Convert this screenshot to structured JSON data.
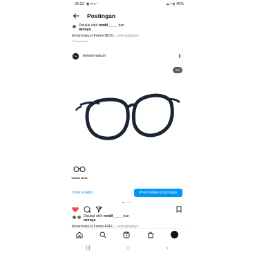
{
  "status_bar": {
    "time": "09.22",
    "battery": "45%",
    "left_glyphs": "▣ ✉ ▸ •",
    "right_glyphs": "☁ ▾ ▮"
  },
  "header": {
    "title": "Postingan"
  },
  "previous_post": {
    "liked_prefix": "Disukai oleh ",
    "liked_user": "rendil_____",
    "liked_mid": " dan ",
    "liked_suffix": "lainnya",
    "caption_user": "temanmata.in",
    "caption_text": " Frame NIOO...",
    "caption_more": " selengkapnya",
    "date": "5 September"
  },
  "post": {
    "username": "temanmata.in",
    "avatar_label": "TM",
    "counter": "1/4",
    "brand_label": "TEMAN MATA"
  },
  "actions": {
    "insight": "Lihat Insight",
    "promote": "Promosikan postingan"
  },
  "next_post": {
    "liked_prefix": "Disukai oleh ",
    "liked_user": "rendil_____",
    "liked_mid": " dan ",
    "liked_suffix": "lainnya",
    "caption_user": "temanmata.in",
    "caption_text": " Frame AXEL...",
    "caption_more": " selengkapnya"
  },
  "bottom_nav": {
    "avatar_label": "TM"
  },
  "system_nav": {
    "recents": "|||",
    "home": "○",
    "back": "‹"
  },
  "colors": {
    "accent": "#0095f6",
    "like": "#ed4956",
    "frame": "#1b2433"
  }
}
